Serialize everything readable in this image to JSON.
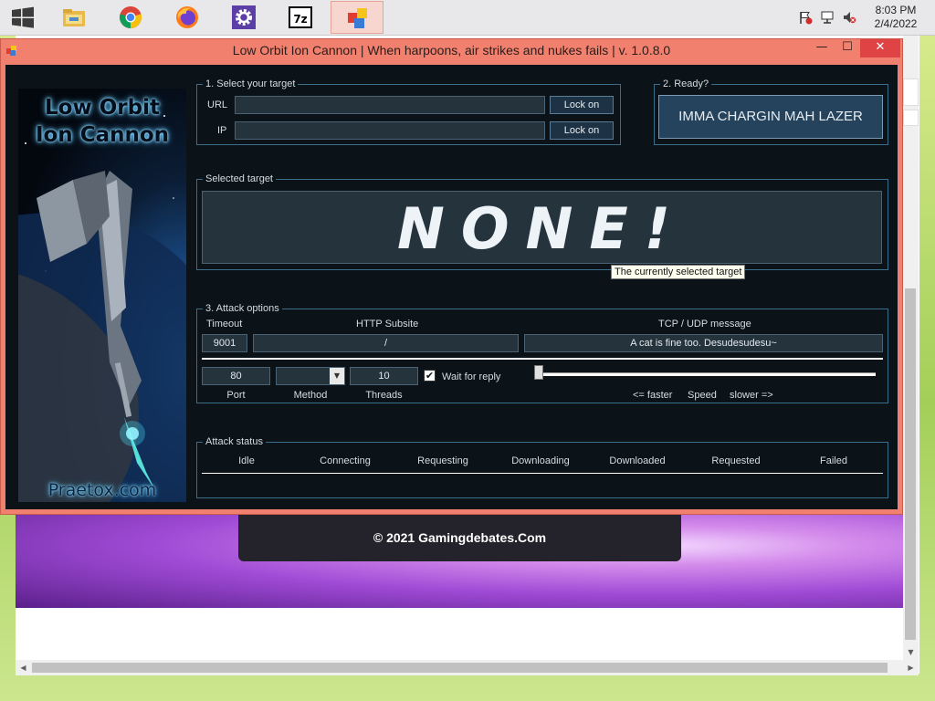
{
  "taskbar": {
    "apps": [
      {
        "name": "file-explorer"
      },
      {
        "name": "chrome"
      },
      {
        "name": "firefox"
      },
      {
        "name": "settings"
      },
      {
        "name": "7zip",
        "label": "7z"
      },
      {
        "name": "loic",
        "active": true
      }
    ],
    "time": "8:03 PM",
    "date": "2/4/2022"
  },
  "browser": {
    "footer_text": "© 2021 Gamingdebates.Com"
  },
  "window": {
    "title": "Low Orbit Ion Cannon | When harpoons, air strikes and nukes fails | v. 1.0.8.0",
    "minimize_glyph": "—",
    "maximize_glyph": "☐",
    "close_glyph": "✕"
  },
  "logo": {
    "title_line1": "Low Orbit",
    "title_line2": "Ion Cannon",
    "site": "Praetox.com"
  },
  "target": {
    "group_label": "1. Select your target",
    "url_label": "URL",
    "ip_label": "IP",
    "url_value": "",
    "ip_value": "",
    "lock_url_button": "Lock on",
    "lock_ip_button": "Lock on"
  },
  "ready": {
    "group_label": "2. Ready?",
    "fire_button": "IMMA CHARGIN MAH LAZER"
  },
  "selected": {
    "group_label": "Selected target",
    "value": "NONE!",
    "tooltip": "The currently selected target"
  },
  "options": {
    "group_label": "3. Attack options",
    "timeout_label": "Timeout",
    "timeout_value": "9001",
    "subsite_label": "HTTP Subsite",
    "subsite_value": "/",
    "message_label": "TCP / UDP message",
    "message_value": "A cat is fine too. Desudesudesu~",
    "port_value": "80",
    "port_label": "Port",
    "method_value": "",
    "method_label": "Method",
    "threads_value": "10",
    "threads_label": "Threads",
    "wait_checked": true,
    "wait_label": "Wait for reply",
    "speed_faster": "<= faster",
    "speed_label": "Speed",
    "speed_slower": "slower =>",
    "speed_level": 0
  },
  "status": {
    "group_label": "Attack status",
    "columns": [
      "Idle",
      "Connecting",
      "Requesting",
      "Downloading",
      "Downloaded",
      "Requested",
      "Failed"
    ]
  }
}
